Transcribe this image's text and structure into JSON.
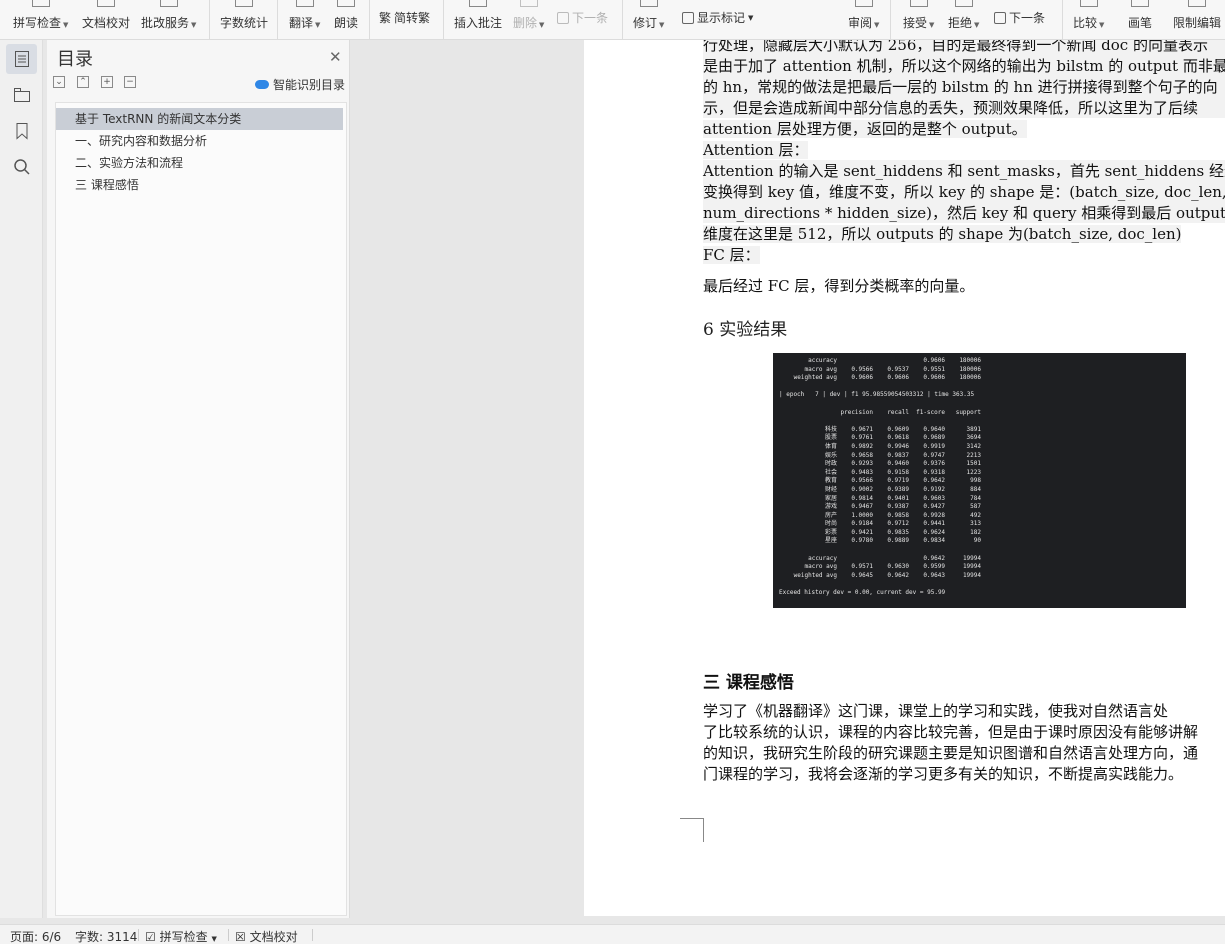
{
  "ribbon": {
    "items": [
      "拼写检查",
      "文档校对",
      "批改服务",
      "字数统计",
      "翻译",
      "朗读",
      "简转繁",
      "插入批注",
      "删除",
      "下一条",
      "修订",
      "显示标记",
      "审阅",
      "接受",
      "拒绝",
      "下一条",
      "比较",
      "画笔",
      "限制编辑"
    ]
  },
  "toc": {
    "title": "目录",
    "smart_label": "智能识别目录",
    "items": [
      "基于 TextRNN 的新闻文本分类",
      "一、研究内容和数据分析",
      "二、实验方法和流程",
      "三  课程感悟"
    ]
  },
  "doc": {
    "lines": [
      "行处理，隐藏层大小默认为 256，目的是最终得到一个新闻 doc 的向量表示",
      "是由于加了 attention 机制，所以这个网络的输出为 bilstm 的 output 而非最后",
      "的 hn，常规的做法是把最后一层的 bilstm 的 hn 进行拼接得到整个句子的向",
      "示，但是会造成新闻中部分信息的丢失，预测效果降低，所以这里为了后续",
      "attention 层处理方便，返回的是整个 output。",
      "Attention 层：",
      "    Attention 的输入是 sent_hiddens 和 sent_masks，首先 sent_hiddens 经过线",
      "变换得到 key 值，维度不变，所以 key 的 shape 是：(batch_size, doc_len,",
      "num_directions * hidden_size)，然后 key 和 query 相乘得到最后 outputs，quer",
      "维度在这里是 512，所以 outputs 的 shape 为(batch_size, doc_len)",
      "FC 层：",
      "    最后经过 FC 层，得到分类概率的向量。"
    ],
    "section6": "6  实验结果",
    "section3": "三  课程感悟",
    "para3": [
      "    学习了《机器翻译》这门课，课堂上的学习和实践，使我对自然语言处",
      "了比较系统的认识，课程的内容比较完善，但是由于课时原因没有能够讲解",
      "的知识，我研究生阶段的研究课题主要是知识图谱和自然语言处理方向，通",
      "门课程的学习，我将会逐渐的学习更多有关的知识，不断提高实践能力。"
    ]
  },
  "terminal": {
    "top": [
      [
        "accuracy",
        "",
        "",
        "0.9606",
        "180006"
      ],
      [
        "macro avg",
        "0.9566",
        "0.9537",
        "0.9551",
        "180006"
      ],
      [
        "weighted avg",
        "0.9606",
        "0.9606",
        "0.9606",
        "180006"
      ]
    ],
    "epoch_line": "| epoch   7 | dev | f1 95.98559054503312 | time 363.35",
    "header": [
      "precision",
      "recall",
      "f1-score",
      "support"
    ],
    "rows": [
      [
        "科技",
        "0.9671",
        "0.9609",
        "0.9640",
        "3891"
      ],
      [
        "股票",
        "0.9761",
        "0.9618",
        "0.9689",
        "3694"
      ],
      [
        "体育",
        "0.9892",
        "0.9946",
        "0.9919",
        "3142"
      ],
      [
        "娱乐",
        "0.9658",
        "0.9837",
        "0.9747",
        "2213"
      ],
      [
        "时政",
        "0.9293",
        "0.9460",
        "0.9376",
        "1501"
      ],
      [
        "社会",
        "0.9483",
        "0.9158",
        "0.9318",
        "1223"
      ],
      [
        "教育",
        "0.9566",
        "0.9719",
        "0.9642",
        "998"
      ],
      [
        "财经",
        "0.9002",
        "0.9389",
        "0.9192",
        "884"
      ],
      [
        "家居",
        "0.9814",
        "0.9401",
        "0.9603",
        "784"
      ],
      [
        "游戏",
        "0.9467",
        "0.9387",
        "0.9427",
        "587"
      ],
      [
        "房产",
        "1.0000",
        "0.9858",
        "0.9928",
        "492"
      ],
      [
        "时尚",
        "0.9184",
        "0.9712",
        "0.9441",
        "313"
      ],
      [
        "彩票",
        "0.9421",
        "0.9835",
        "0.9624",
        "182"
      ],
      [
        "星座",
        "0.9780",
        "0.9889",
        "0.9834",
        "90"
      ]
    ],
    "bottom": [
      [
        "accuracy",
        "",
        "",
        "0.9642",
        "19994"
      ],
      [
        "macro avg",
        "0.9571",
        "0.9630",
        "0.9599",
        "19994"
      ],
      [
        "weighted avg",
        "0.9645",
        "0.9642",
        "0.9643",
        "19994"
      ]
    ],
    "footer": "Exceed history dev = 0.00, current dev = 95.99"
  },
  "status": {
    "page": "页面: 6/6",
    "words": "字数: 3114",
    "spell": "拼写检查",
    "proof": "文档校对"
  }
}
